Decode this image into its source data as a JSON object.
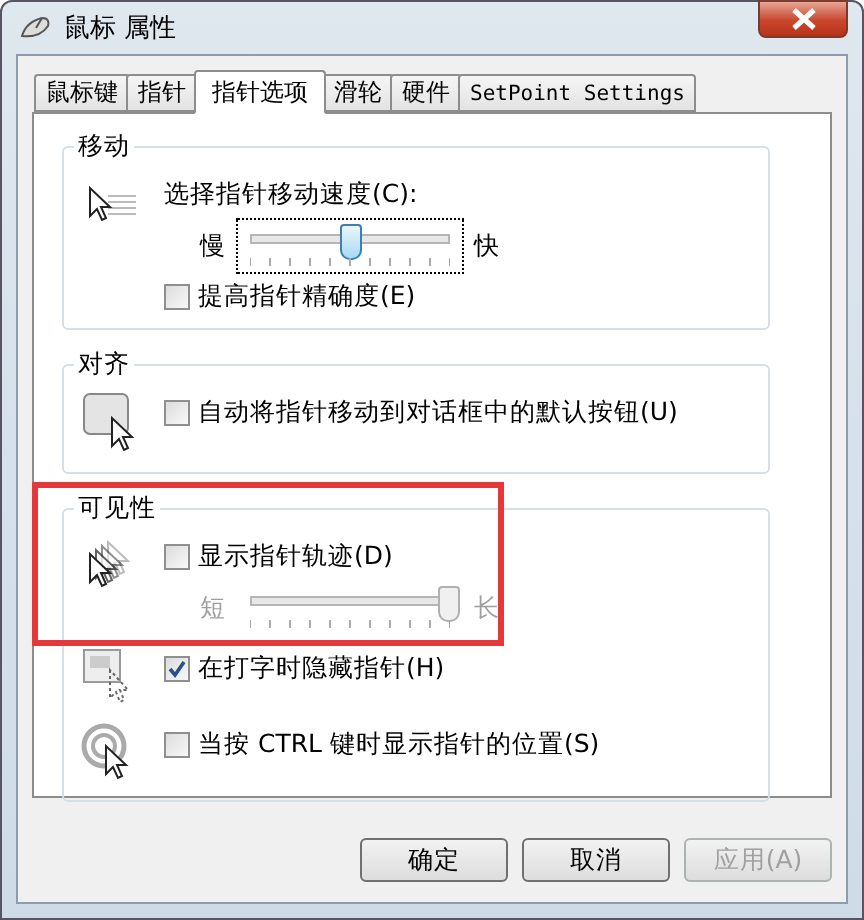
{
  "window": {
    "title": "鼠标 属性"
  },
  "tabs": [
    {
      "label": "鼠标键",
      "selected": false
    },
    {
      "label": "指针",
      "selected": false
    },
    {
      "label": "指针选项",
      "selected": true
    },
    {
      "label": "滑轮",
      "selected": false
    },
    {
      "label": "硬件",
      "selected": false
    },
    {
      "label": "SetPoint Settings",
      "selected": false,
      "kind": "mono"
    }
  ],
  "groups": [
    {
      "title": "移动",
      "sections": [
        {
          "items": [
            {
              "kind": "label",
              "text": "选择指针移动速度(C):"
            },
            {
              "kind": "slider",
              "min_label": "慢",
              "max_label": "快",
              "level": 0.5,
              "disabled": false,
              "focused": true
            },
            {
              "kind": "checkbox",
              "label": "提高指针精确度(E)",
              "checked": false
            }
          ]
        }
      ]
    },
    {
      "title": "对齐",
      "sections": [
        {
          "items": [
            {
              "kind": "checkbox",
              "label": "自动将指针移动到对话框中的默认按钮(U)",
              "checked": false
            }
          ]
        }
      ]
    },
    {
      "title": "可见性",
      "highlighted": true,
      "sections": [
        {
          "items": [
            {
              "kind": "checkbox",
              "label": "显示指针轨迹(D)",
              "checked": false
            },
            {
              "kind": "slider",
              "min_label": "短",
              "max_label": "长",
              "level": 1,
              "disabled": true,
              "focused": false
            }
          ]
        },
        {
          "items": [
            {
              "kind": "checkbox",
              "label": "在打字时隐藏指针(H)",
              "checked": true
            }
          ]
        },
        {
          "items": [
            {
              "kind": "checkbox",
              "label": "当按 CTRL 键时显示指针的位置(S)",
              "checked": false
            }
          ]
        }
      ]
    }
  ],
  "buttons": [
    {
      "label": "确定",
      "disabled": false
    },
    {
      "label": "取消",
      "disabled": false
    },
    {
      "label": "应用(A)",
      "disabled": true
    }
  ]
}
